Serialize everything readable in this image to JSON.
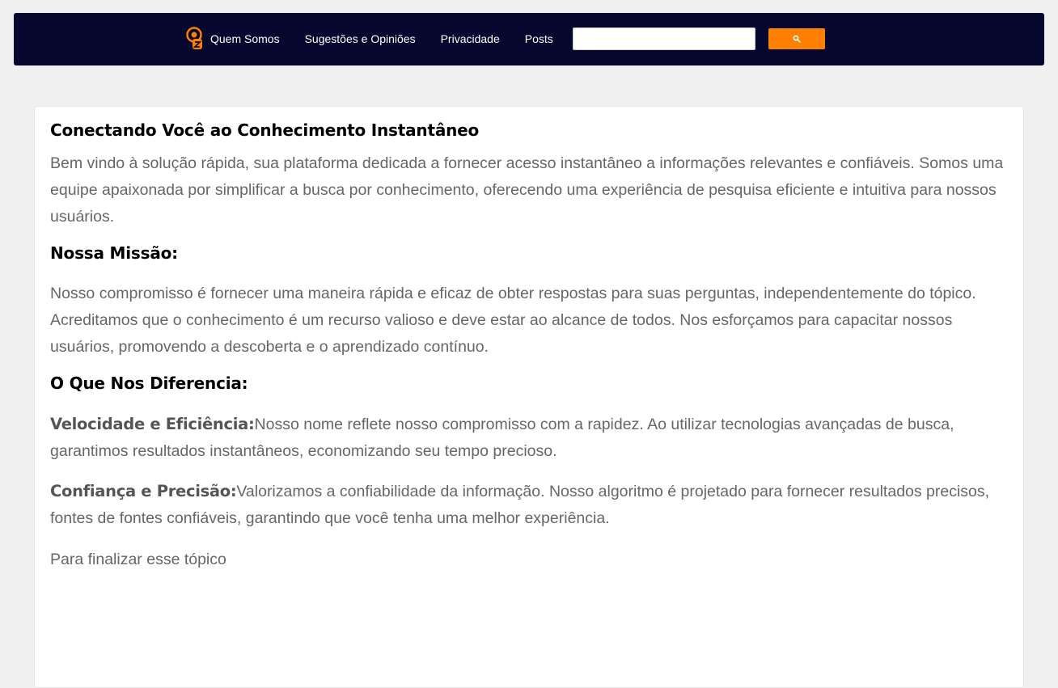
{
  "nav": {
    "links": [
      "Quem Somos",
      "Sugestões e Opiniões",
      "Privacidade",
      "Posts"
    ],
    "search": {
      "value": "",
      "placeholder": ""
    },
    "search_button_icon": "search-icon",
    "colors": {
      "bar": "#05072e",
      "accent": "#ff7f00"
    }
  },
  "content": {
    "title": "Conectando Você ao Conhecimento Instantâneo",
    "intro": "Bem vindo à solução rápida, sua plataforma dedicada a fornecer acesso instantâneo a informações relevantes e confiáveis. Somos uma equipe apaixonada por simplificar a busca por conhecimento, oferecendo uma experiência de pesquisa eficiente e intuitiva para nossos usuários.",
    "mission_heading": "Nossa Missão:",
    "mission_text": "Nosso compromisso é fornecer uma maneira rápida e eficaz de obter respostas para suas perguntas, independentemente do tópico. Acreditamos que o conhecimento é um recurso valioso e deve estar ao alcance de todos. Nos esforçamos para capacitar nossos usuários, promovendo a descoberta e o aprendizado contínuo.",
    "diff_heading": "O Que Nos Diferencia:",
    "diff_items": [
      {
        "label": "Velocidade e Eficiência:",
        "text": "Nosso nome reflete nosso compromisso com a rapidez. Ao utilizar tecnologias avançadas de busca, garantimos resultados instantâneos, economizando seu tempo precioso."
      },
      {
        "label": "Confiança e Precisão:",
        "text": "Valorizamos a confiabilidade da informação. Nosso algoritmo é projetado para fornecer resultados precisos, fontes de fontes confiáveis, garantindo que você tenha uma melhor experiência."
      }
    ],
    "closing": "Para finalizar esse tópico"
  }
}
